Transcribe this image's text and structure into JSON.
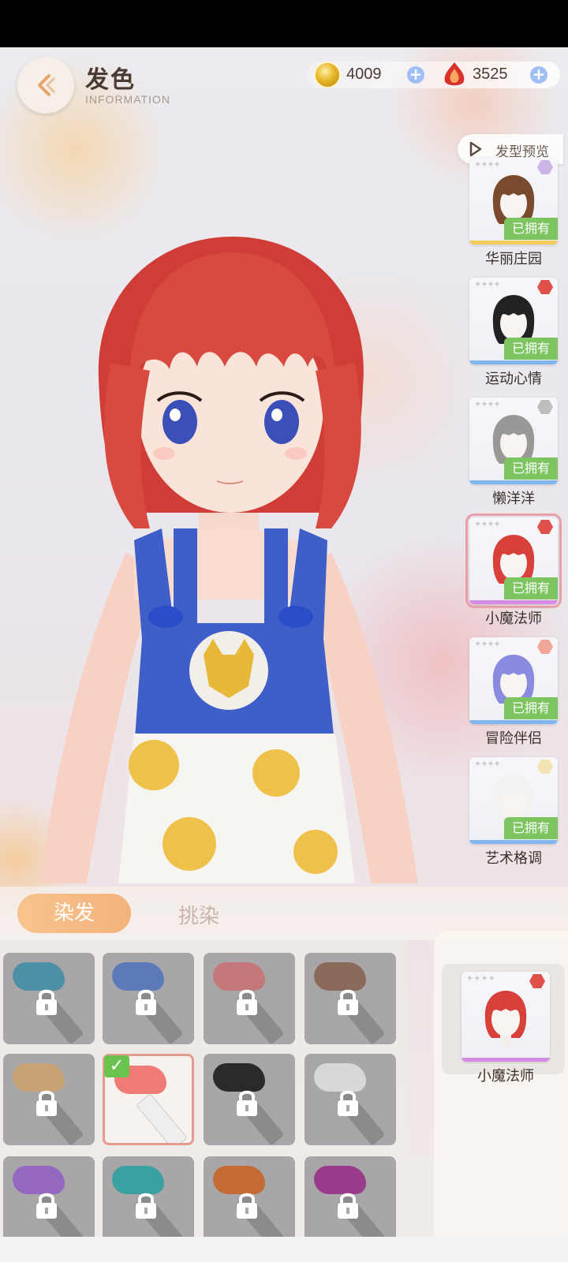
{
  "header": {
    "title": "发色",
    "subtitle": "INFORMATION"
  },
  "currency": {
    "coins": "4009",
    "gems": "3525"
  },
  "hairstyle_panel": {
    "preview_label": "发型预览",
    "owned_label": "已拥有",
    "items": [
      {
        "name": "华丽庄园",
        "hair_color": "#7a4a2e",
        "badge_color": "#c9b6e6",
        "selected": false
      },
      {
        "name": "运动心情",
        "hair_color": "#222222",
        "badge_color": "#e0504a",
        "selected": false
      },
      {
        "name": "懒洋洋",
        "hair_color": "#9a9896",
        "badge_color": "#bdbdbd",
        "selected": false
      },
      {
        "name": "小魔法师",
        "hair_color": "#d8403a",
        "badge_color": "#e0504a",
        "selected": true
      },
      {
        "name": "冒险伴侣",
        "hair_color": "#8a8ae0",
        "badge_color": "#f2a69a",
        "selected": false
      },
      {
        "name": "艺术格调",
        "hair_color": "#f2f2f2",
        "badge_color": "#f3e3b0",
        "selected": false
      }
    ]
  },
  "tabs": {
    "dye": "染发",
    "highlight": "挑染"
  },
  "swatches": [
    {
      "color": "#4d8fa4",
      "locked": true
    },
    {
      "color": "#5d7ab8",
      "locked": true
    },
    {
      "color": "#c4787a",
      "locked": true
    },
    {
      "color": "#8a6a5a",
      "locked": true
    },
    {
      "color": "#c8a474",
      "locked": true
    },
    {
      "color": "#ee7c74",
      "locked": false,
      "selected": true
    },
    {
      "color": "#2a2a2a",
      "locked": true
    },
    {
      "color": "#d8d8d8",
      "locked": true
    },
    {
      "color": "#9468c0",
      "locked": true
    },
    {
      "color": "#3aa0a0",
      "locked": true
    },
    {
      "color": "#c46a34",
      "locked": true
    },
    {
      "color": "#9a3c8c",
      "locked": true
    }
  ],
  "current": {
    "name": "小魔法师"
  }
}
